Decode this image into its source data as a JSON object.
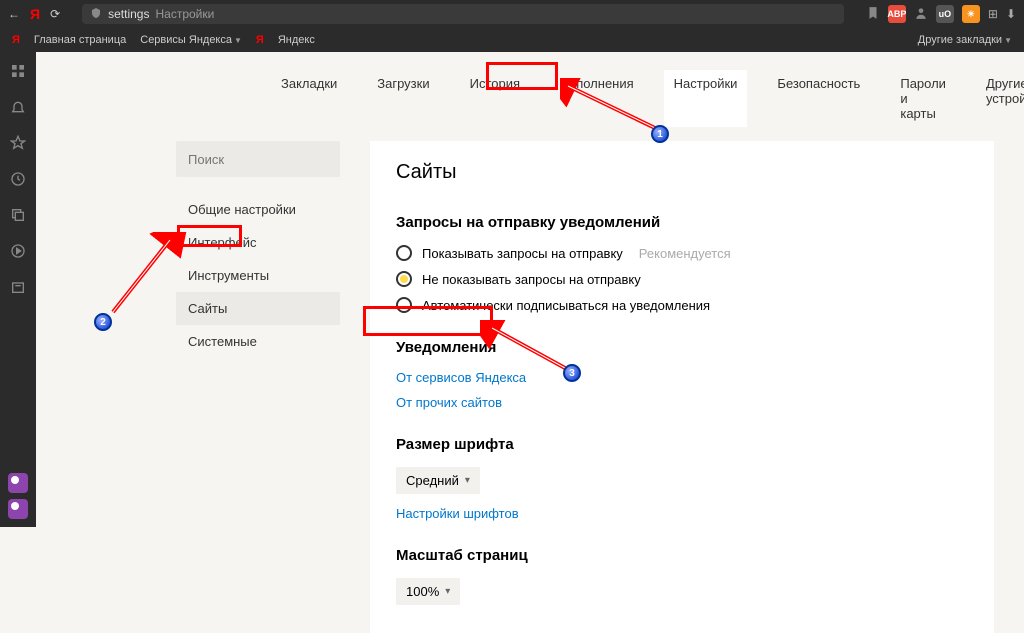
{
  "titlebar": {
    "address_prefix": "settings",
    "address_text": "Настройки"
  },
  "bookmarks": {
    "main_page": "Главная страница",
    "yandex_services": "Сервисы Яндекса",
    "yandex": "Яндекс",
    "other": "Другие закладки"
  },
  "tabs": {
    "bookmarks": "Закладки",
    "downloads": "Загрузки",
    "history": "История",
    "addons": "Дополнения",
    "settings": "Настройки",
    "security": "Безопасность",
    "passwords": "Пароли и карты",
    "devices": "Другие устройства"
  },
  "search": {
    "placeholder": "Поиск"
  },
  "menu": {
    "general": "Общие настройки",
    "interface": "Интерфейс",
    "tools": "Инструменты",
    "sites": "Сайты",
    "system": "Системные"
  },
  "panel": {
    "title": "Сайты",
    "notif_requests_title": "Запросы на отправку уведомлений",
    "opt_show": "Показывать запросы на отправку",
    "recommended": "Рекомендуется",
    "opt_hide": "Не показывать запросы на отправку",
    "opt_auto": "Автоматически подписываться на уведомления",
    "notifications_title": "Уведомления",
    "link_yandex_services": "От сервисов Яндекса",
    "link_other_sites": "От прочих сайтов",
    "font_size_title": "Размер шрифта",
    "font_size_value": "Средний",
    "font_settings": "Настройки шрифтов",
    "page_scale_title": "Масштаб страниц",
    "page_scale_value": "100%"
  },
  "steps": {
    "s1": "1",
    "s2": "2",
    "s3": "3"
  }
}
